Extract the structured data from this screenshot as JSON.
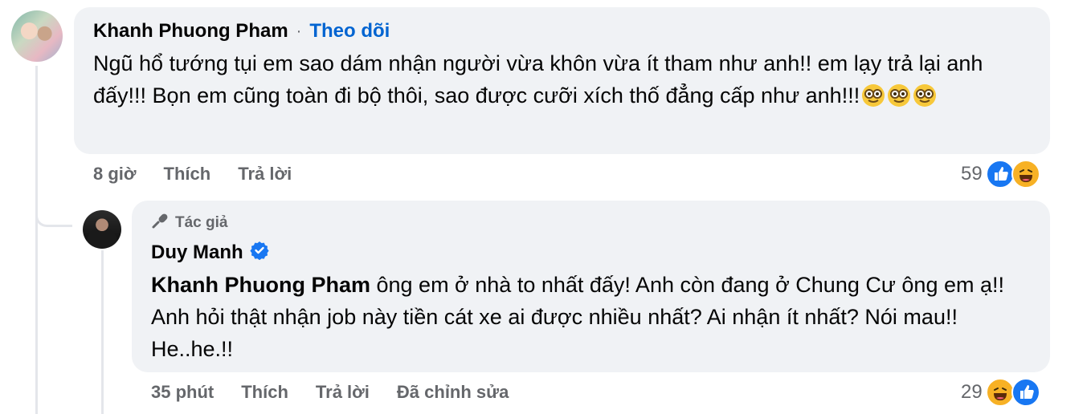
{
  "comment": {
    "author": "Khanh Phuong Pham",
    "separator": "·",
    "follow_label": "Theo dõi",
    "text": "Ngũ hổ tướng tụi em sao dám nhận người vừa khôn vừa ít tham như anh!! em lạy trả lại anh đấy!!! Bọn em cũng toàn đi bộ thôi, sao được cưỡi xích thố đẳng cấp như anh!!!",
    "emojis": [
      "nerd-face",
      "nerd-face",
      "nerd-face"
    ],
    "time": "8 giờ",
    "like_label": "Thích",
    "reply_label": "Trả lời",
    "reaction_count": "59",
    "reactions": [
      "like",
      "laugh"
    ]
  },
  "reply": {
    "badge_label": "Tác giả",
    "author": "Duy Manh",
    "verified": true,
    "tagged_name": "Khanh Phuong Pham",
    "text": " ông em ở nhà to nhất đấy! Anh còn đang ở Chung Cư ông em ạ!! Anh hỏi thật nhận job này tiền cát xe ai được nhiều nhất? Ai nhận ít nhất? Nói mau!! He..he.!!",
    "time": "35 phút",
    "like_label": "Thích",
    "reply_label": "Trả lời",
    "edited_label": "Đã chỉnh sửa",
    "reaction_count": "29",
    "reactions": [
      "laugh",
      "like"
    ]
  },
  "colors": {
    "bubble": "#f0f2f5",
    "link_blue": "#0064d1",
    "muted": "#65676b",
    "like_blue": "#1877f2",
    "laugh_yellow": "#f7b125"
  }
}
